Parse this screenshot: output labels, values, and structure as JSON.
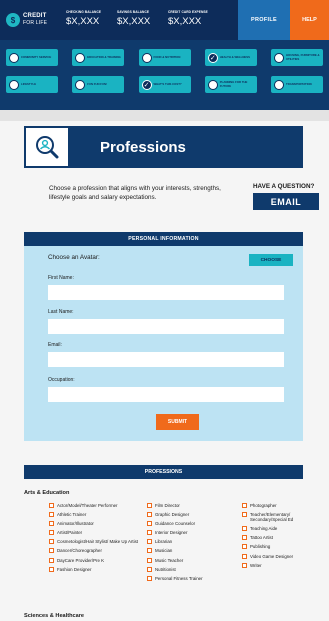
{
  "header": {
    "logo_line1": "CREDIT",
    "logo_line2": "FOR LIFE",
    "balances": [
      {
        "label": "CHECKING BALANCE",
        "value": "$X,XXX"
      },
      {
        "label": "SAVINGS BALANCE",
        "value": "$X,XXX"
      },
      {
        "label": "CREDIT CARD EXPENSE",
        "value": "$X,XXX"
      }
    ],
    "profile": "PROFILE",
    "help": "HELP"
  },
  "categories": [
    {
      "label": "COMMUNITY SERVICE",
      "checked": false
    },
    {
      "label": "EDUCATION & TRAINING",
      "checked": false
    },
    {
      "label": "FOOD & NUTRITION",
      "checked": false
    },
    {
      "label": "HEALTH & WELLNESS",
      "checked": true
    },
    {
      "label": "HOUSING, FURNITURE & UTILITIES",
      "checked": false
    },
    {
      "label": "LIFESTYLE",
      "checked": false
    },
    {
      "label": "FUN FUN FUN!",
      "checked": false
    },
    {
      "label": "WHAT'S THIS COST?",
      "checked": true
    },
    {
      "label": "PLANNING FOR THE FUTURE",
      "checked": false
    },
    {
      "label": "TRANSPORTATION",
      "checked": false
    }
  ],
  "hero": {
    "title": "Professions",
    "icon": "profession-search-icon"
  },
  "intro": "Choose a profession that aligns with your interests, strengths, lifestyle goals and salary expectations.",
  "question": {
    "heading": "HAVE A QUESTION?",
    "email": "EMAIL"
  },
  "personal": {
    "heading": "PERSONAL INFORMATION",
    "avatar_label": "Choose an Avatar:",
    "choose": "CHOOSE",
    "fields": [
      "First Name:",
      "Last Name:",
      "Email:",
      "Occupation:"
    ],
    "submit": "SUBMIT"
  },
  "professions": {
    "heading": "PROFESSIONS",
    "groups": [
      {
        "title": "Arts & Education",
        "columns": [
          [
            "Actor/Model/Theater Performer",
            "Athletic Trainer",
            "Animator/Illustrator",
            "Artist/Painter",
            "Cosmetologist/Hair Stylist/ Make Up Artist",
            "Dancer/Choreographer",
            "DayCare Provider/Pre K",
            "Fashion Designer"
          ],
          [
            "Film Director",
            "Graphic Designer",
            "Guidance Counselor",
            "Interior Designer",
            "Librarian",
            "Musician",
            "Music Teacher",
            "Nutritionist",
            "Personal Fitness Trainer"
          ],
          [
            "Photographer",
            "Teacher/Elementary/ Secondary/Special Ed",
            "Teaching Aide",
            "Tattoo Artist",
            "Publishing",
            "Video Game Designer",
            "Writer"
          ]
        ]
      },
      {
        "title": "Sciences & Healthcare"
      }
    ]
  }
}
